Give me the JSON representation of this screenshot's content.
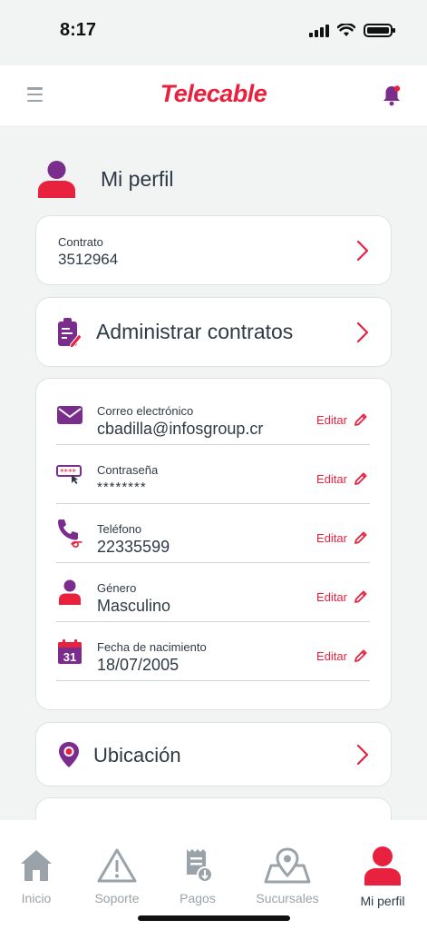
{
  "status_bar": {
    "time": "8:17"
  },
  "header": {
    "logo_text": "Telecable"
  },
  "profile": {
    "title": "Mi perfil"
  },
  "contract": {
    "label": "Contrato",
    "value": "3512964"
  },
  "admin": {
    "title": "Administrar contratos"
  },
  "info_rows": [
    {
      "label": "Correo electrónico",
      "value": "cbadilla@infosgroup.cr",
      "edit": "Editar",
      "icon": "mail-icon"
    },
    {
      "label": "Contraseña",
      "value": "********",
      "edit": "Editar",
      "icon": "password-icon"
    },
    {
      "label": "Teléfono",
      "value": "22335599",
      "edit": "Editar",
      "icon": "phone-icon"
    },
    {
      "label": "Género",
      "value": "Masculino",
      "edit": "Editar",
      "icon": "user-icon"
    },
    {
      "label": "Fecha de nacimiento",
      "value": "18/07/2005",
      "edit": "Editar",
      "icon": "calendar-icon",
      "calendar_day": "31"
    }
  ],
  "location": {
    "title": "Ubicación"
  },
  "tabs": [
    {
      "label": "Inicio",
      "icon": "home-icon"
    },
    {
      "label": "Soporte",
      "icon": "warning-icon"
    },
    {
      "label": "Pagos",
      "icon": "receipt-icon"
    },
    {
      "label": "Sucursales",
      "icon": "map-pin-icon"
    },
    {
      "label": "Mi perfil",
      "icon": "profile-icon",
      "active": true
    }
  ],
  "colors": {
    "accent": "#e8213f",
    "purple": "#7b2d8e",
    "text": "#2e3a45",
    "inactive": "#9aa3aa",
    "background": "#f2f3f3"
  }
}
